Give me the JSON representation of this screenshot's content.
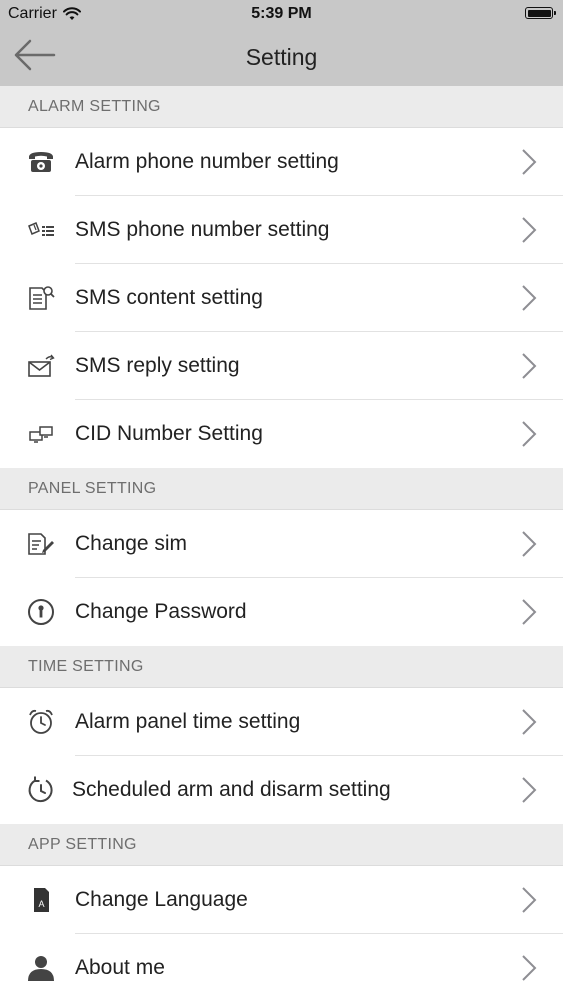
{
  "status_bar": {
    "carrier": "Carrier",
    "time": "5:39 PM"
  },
  "header": {
    "title": "Setting"
  },
  "sections": [
    {
      "title": "ALARM SETTING",
      "items": [
        {
          "label": "Alarm phone number setting",
          "icon": "telephone-icon"
        },
        {
          "label": "SMS phone number setting",
          "icon": "sms-list-icon"
        },
        {
          "label": "SMS content setting",
          "icon": "document-search-icon"
        },
        {
          "label": "SMS reply setting",
          "icon": "envelope-reply-icon"
        },
        {
          "label": "CID Number Setting",
          "icon": "monitor-network-icon"
        }
      ]
    },
    {
      "title": "PANEL SETTING",
      "items": [
        {
          "label": "Change sim",
          "icon": "document-edit-icon"
        },
        {
          "label": "Change Password",
          "icon": "keyhole-icon"
        }
      ]
    },
    {
      "title": "TIME SETTING",
      "items": [
        {
          "label": "Alarm panel time setting",
          "icon": "alarm-clock-icon"
        },
        {
          "label": "Scheduled arm and disarm setting",
          "icon": "clock-refresh-icon"
        }
      ]
    },
    {
      "title": "APP SETTING",
      "items": [
        {
          "label": "Change Language",
          "icon": "language-file-icon",
          "icon_letter": "A"
        },
        {
          "label": "About me",
          "icon": "person-icon"
        }
      ]
    }
  ],
  "colors": {
    "header_bg": "#c8c8c8",
    "section_bg": "#ebebeb",
    "section_text": "#6e6e6e",
    "chevron": "#8e8e93",
    "separator": "#e2e2e2"
  }
}
